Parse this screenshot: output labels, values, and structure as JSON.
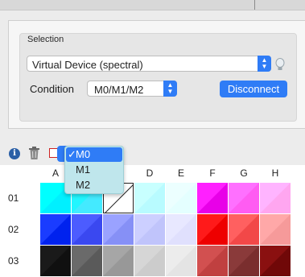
{
  "selection": {
    "title": "Selection",
    "device": "Virtual Device (spectral)",
    "condition_label": "Condition",
    "condition_value": "M0/M1/M2",
    "disconnect_label": "Disconnect"
  },
  "toolbar": {
    "info": "i"
  },
  "dropdown": {
    "items": [
      {
        "label": "M0",
        "selected": true
      },
      {
        "label": "M1",
        "selected": false
      },
      {
        "label": "M2",
        "selected": false
      }
    ],
    "check": "✓"
  },
  "grid": {
    "columns": [
      "A",
      "B",
      "C",
      "D",
      "E",
      "F",
      "G",
      "H"
    ],
    "rows": [
      {
        "label": "01",
        "cells": [
          [
            "#00ffff",
            "#00f0ff"
          ],
          [
            "#22f6ff",
            "#44eaff"
          ],
          [
            "#ffffff",
            "#ffffff"
          ],
          [
            "#c8ffff",
            "#b8fbff"
          ],
          [
            "#ecffff",
            "#e4ffff"
          ],
          [
            "#ff20ff",
            "#e800e8"
          ],
          [
            "#ff70ff",
            "#ff5cf2"
          ],
          [
            "#ffb4ff",
            "#ffa6f0"
          ]
        ]
      },
      {
        "label": "02",
        "cells": [
          [
            "#1a3cff",
            "#0022ee"
          ],
          [
            "#4c5cff",
            "#3a48f0"
          ],
          [
            "#9aa2ff",
            "#8690f6"
          ],
          [
            "#cccfff",
            "#c0c4fb"
          ],
          [
            "#e8e8ff",
            "#e0e0fd"
          ],
          [
            "#ff1a1a",
            "#ee0000"
          ],
          [
            "#ff6060",
            "#f24848"
          ],
          [
            "#ffa8a8",
            "#f69a9a"
          ]
        ]
      },
      {
        "label": "03",
        "cells": [
          [
            "#1a1a1a",
            "#101010"
          ],
          [
            "#6a6a6a",
            "#5a5a5a"
          ],
          [
            "#a6a6a6",
            "#989898"
          ],
          [
            "#d6d6d6",
            "#cccccc"
          ],
          [
            "#ececec",
            "#e4e4e4"
          ],
          [
            "#d25050",
            "#c04040"
          ],
          [
            "#8a3a3a",
            "#7a2e2e"
          ],
          [
            "#8a1010",
            "#700808"
          ]
        ]
      }
    ]
  },
  "icons": [
    "info-icon",
    "trash-icon",
    "tool-icon",
    "bulb-icon",
    "stepper-icon",
    "checkmark-icon"
  ]
}
